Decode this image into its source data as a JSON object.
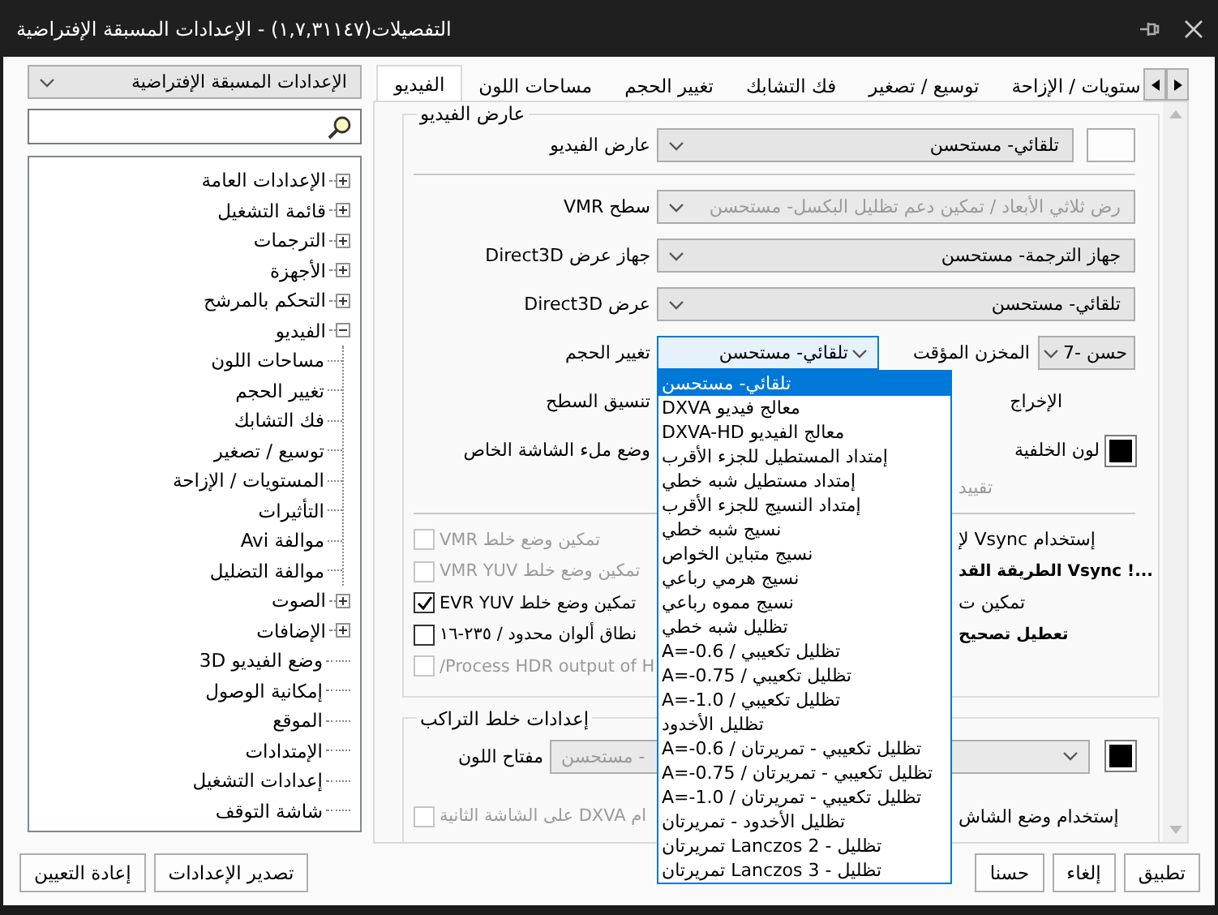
{
  "window": {
    "title": "التفصيلات(١,٧,٣١١٤٧) - الإعدادات المسبقة الإفتراضية"
  },
  "preset": {
    "value": "الإعدادات المسبقة الإفتراضية"
  },
  "tree": [
    {
      "label": "الإعدادات العامة",
      "kind": "folder",
      "expanded": false
    },
    {
      "label": "قائمة التشغيل",
      "kind": "folder",
      "expanded": false
    },
    {
      "label": "الترجمات",
      "kind": "folder",
      "expanded": false
    },
    {
      "label": "الأجهزة",
      "kind": "folder",
      "expanded": false
    },
    {
      "label": "التحكم بالمرشح",
      "kind": "folder",
      "expanded": false
    },
    {
      "label": "الفيديو",
      "kind": "folder",
      "expanded": true,
      "children": [
        {
          "label": "مساحات اللون"
        },
        {
          "label": "تغيير الحجم"
        },
        {
          "label": "فك التشابك"
        },
        {
          "label": "توسيع / تصغير"
        },
        {
          "label": "المستويات / الإزاحة"
        },
        {
          "label": "التأثيرات"
        },
        {
          "label": "موالفة Avi"
        },
        {
          "label": "موالفة التضليل"
        }
      ]
    },
    {
      "label": "الصوت",
      "kind": "folder",
      "expanded": false
    },
    {
      "label": "الإضافات",
      "kind": "folder",
      "expanded": false
    },
    {
      "label": "وضع الفيديو 3D",
      "kind": "leaf"
    },
    {
      "label": "إمكانية الوصول",
      "kind": "leaf"
    },
    {
      "label": "الموقع",
      "kind": "leaf"
    },
    {
      "label": "الإمتدادات",
      "kind": "leaf"
    },
    {
      "label": "إعدادات التشغيل",
      "kind": "leaf"
    },
    {
      "label": "شاشة التوقف",
      "kind": "leaf"
    }
  ],
  "tabs": [
    {
      "label": "ستويات / الإزاحة",
      "selected": false
    },
    {
      "label": "توسيع / تصغير",
      "selected": false
    },
    {
      "label": "فك التشابك",
      "selected": false
    },
    {
      "label": "تغيير الحجم",
      "selected": false
    },
    {
      "label": "مساحات اللون",
      "selected": false
    },
    {
      "label": "الفيديو",
      "selected": true
    }
  ],
  "video_renderer": {
    "legend": "عارض الفيديو",
    "label": "عارض الفيديو",
    "value": "تلقائي- مستحسن"
  },
  "combo_rows": [
    {
      "label": "سطح VMR",
      "value": "رض ثلاثي الأبعاد / تمكين دعم تظليل البكسل- مستحسن",
      "disabled": true
    },
    {
      "label": "جهاز عرض Direct3D",
      "value": "جهاز الترجمة- مستحسن",
      "disabled": false
    },
    {
      "label": "عرض Direct3D",
      "value": "تلقائي- مستحسن",
      "disabled": false
    }
  ],
  "resize": {
    "label": "تغيير الحجم",
    "value": "تلقائي- مستحسن",
    "expanded": true,
    "options": [
      {
        "label": "تلقائي- مستحسن",
        "selected": true
      },
      {
        "label": "معالج فيديو DXVA",
        "selected": false
      },
      {
        "label": "معالج الفيديو DXVA-HD",
        "selected": false
      },
      {
        "label": "إمتداد المستطيل للجزء الأقرب",
        "selected": false
      },
      {
        "label": "إمتداد مستطيل شبه خطي",
        "selected": false
      },
      {
        "label": "إمتداد النسيج للجزء الأقرب",
        "selected": false
      },
      {
        "label": "نسيج شبه خطي",
        "selected": false
      },
      {
        "label": "نسيج متباين الخواص",
        "selected": false
      },
      {
        "label": "نسيج هرمي رباعي",
        "selected": false
      },
      {
        "label": "نسيج مموه رباعي",
        "selected": false
      },
      {
        "label": "تظليل شبه خطي",
        "selected": false
      },
      {
        "label": "تظليل تكعيبي / A=-0.6",
        "selected": false
      },
      {
        "label": "تظليل تكعيبي / A=-0.75",
        "selected": false
      },
      {
        "label": "تظليل تكعيبي / A=-1.0",
        "selected": false
      },
      {
        "label": "تظليل الأخدود",
        "selected": false
      },
      {
        "label": "تظليل تكعيبي - تمريرتان / A=-0.6",
        "selected": false
      },
      {
        "label": "تظليل تكعيبي - تمريرتان / A=-0.75",
        "selected": false
      },
      {
        "label": "تظليل تكعيبي - تمريرتان / A=-1.0",
        "selected": false
      },
      {
        "label": "تظليل الأخدود - تمريرتان",
        "selected": false
      },
      {
        "label": "تظليل - Lanczos 2 تمريرتان",
        "selected": false
      },
      {
        "label": "تظليل - Lanczos 3 تمريرتان",
        "selected": false
      }
    ]
  },
  "buffer": {
    "label": "المخزن المؤقت",
    "value": "حسن -7"
  },
  "surface_format": {
    "label": "تنسيق السطح"
  },
  "output": {
    "label": "الإخراج"
  },
  "fullscreen_mode": {
    "label": "وضع ملء الشاشة الخاص"
  },
  "background_color": {
    "label": "لون الخلفية"
  },
  "limit": {
    "label": "تقييد",
    "disabled": true
  },
  "checkboxes_left": [
    {
      "label": "تمكين وضع خلط VMR",
      "checked": false,
      "disabled": true
    },
    {
      "label": "تمكين وضع خلط VMR YUV",
      "checked": false,
      "disabled": true
    },
    {
      "label": "تمكين وضع خلط EVR YUV",
      "checked": true,
      "disabled": false
    },
    {
      "label": "نطاق ألوان محدود / ٢٣٥-١٦",
      "checked": false,
      "disabled": false
    },
    {
      "label": "Process HDR output of H/",
      "checked": false,
      "disabled": true
    }
  ],
  "options_right": [
    {
      "label": "إستخدام Vsync لإ",
      "bold": false
    },
    {
      "label": "...! Vsync الطريقة القد",
      "bold": true
    },
    {
      "label": "تمكين ت",
      "bold": false
    },
    {
      "label": "تعطيل تصحيح",
      "bold": true
    }
  ],
  "overlay_group": {
    "legend": "إعدادات خلط التراكب",
    "label": "مفتاح اللون",
    "value": "- مستحسن",
    "disabled": true
  },
  "second_display": {
    "checkbox_label": "ام DXVA على الشاشة الثانية",
    "checked": false,
    "disabled": true,
    "right_label": "إستخدام وضع الشاش"
  },
  "footer": {
    "right_buttons": [
      "تطبيق",
      "إلغاء",
      "حسنا"
    ],
    "left_buttons": [
      "تصدير الإعدادات",
      "إعادة التعيين"
    ]
  }
}
